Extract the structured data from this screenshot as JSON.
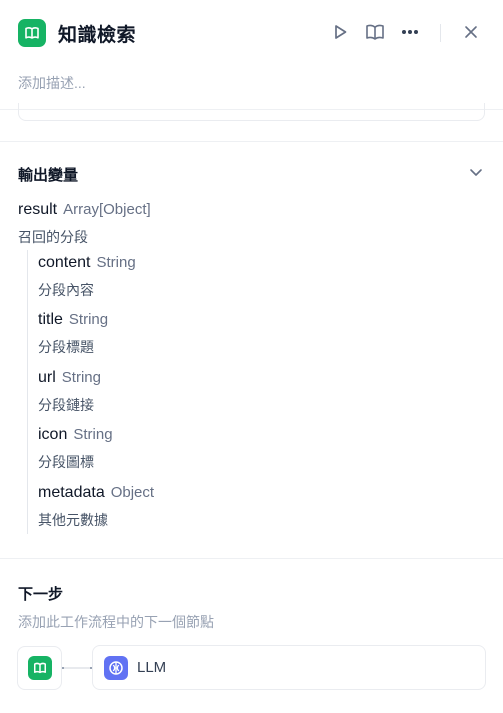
{
  "header": {
    "title": "知識檢索",
    "node_color": "#16b364"
  },
  "description_placeholder": "添加描述...",
  "output_section": {
    "title": "輸出變量",
    "root": {
      "name": "result",
      "type": "Array[Object]",
      "desc": "召回的分段"
    },
    "children": [
      {
        "name": "content",
        "type": "String",
        "desc": "分段內容"
      },
      {
        "name": "title",
        "type": "String",
        "desc": "分段標題"
      },
      {
        "name": "url",
        "type": "String",
        "desc": "分段鏈接"
      },
      {
        "name": "icon",
        "type": "String",
        "desc": "分段圖標"
      },
      {
        "name": "metadata",
        "type": "Object",
        "desc": "其他元數據"
      }
    ]
  },
  "next_step": {
    "title": "下一步",
    "subtitle": "添加此工作流程中的下一個節點",
    "target_label": "LLM",
    "target_color": "#6172f3"
  },
  "icons": [
    "book-icon",
    "play-icon",
    "book-open-icon",
    "more-icon",
    "close-icon",
    "chevron-down-icon",
    "brain-icon"
  ]
}
